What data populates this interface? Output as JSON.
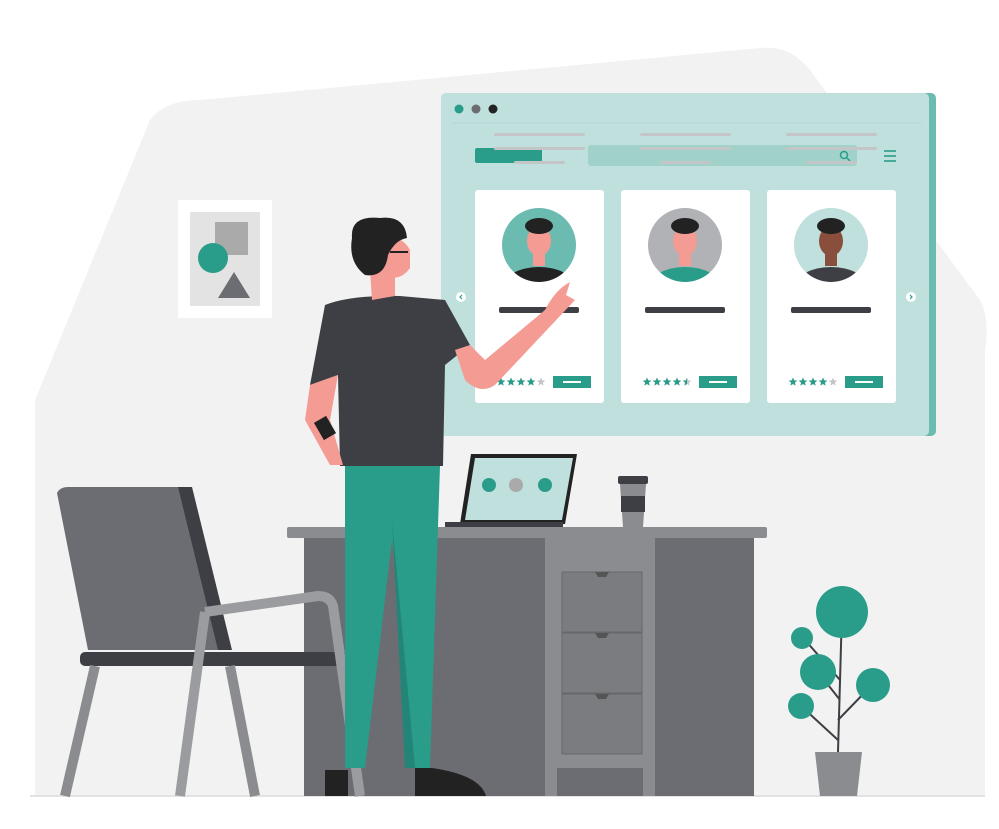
{
  "colors": {
    "accent": "#2a9d8a",
    "screen_bg": "#bfe0dc",
    "search_bg": "#a0d2ca",
    "dark": "#3d3f44",
    "gray": "#6b6d72",
    "skin": "#f49b94",
    "background_blob": "#f2f2f2"
  },
  "profile_cards": [
    {
      "rating": 4,
      "max_rating": 5
    },
    {
      "rating": 4.5,
      "max_rating": 5
    },
    {
      "rating": 4,
      "max_rating": 5
    }
  ]
}
